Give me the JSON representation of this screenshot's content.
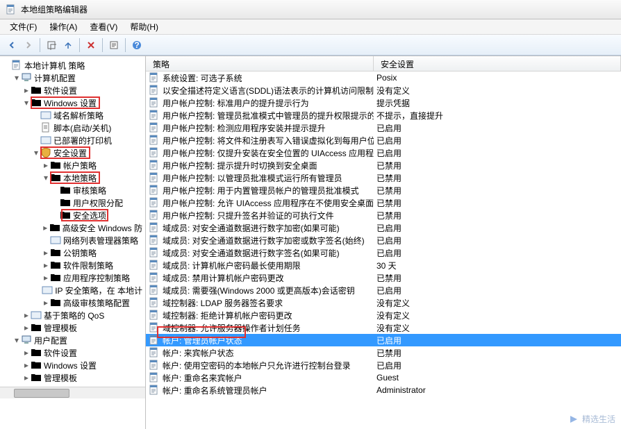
{
  "window": {
    "title": "本地组策略编辑器"
  },
  "menus": {
    "file": "文件(F)",
    "action": "操作(A)",
    "view": "查看(V)",
    "help": "帮助(H)"
  },
  "tree": {
    "root": "本地计算机 策略",
    "computer": "计算机配置",
    "soft1": "软件设置",
    "win_settings": "Windows 设置",
    "dns": "域名解析策略",
    "script": "脚本(启动/关机)",
    "printers": "已部署的打印机",
    "security": "安全设置",
    "acct_policy": "帐户策略",
    "local_policy": "本地策略",
    "audit": "审核策略",
    "user_rights": "用户权限分配",
    "sec_options": "安全选项",
    "adv_fw": "高级安全 Windows 防",
    "netlist": "网络列表管理器策略",
    "pubkey": "公钥策略",
    "softrestrict": "软件限制策略",
    "appctrl": "应用程序控制策略",
    "ipsec": "IP 安全策略，在 本地计",
    "adv_audit": "高级审核策略配置",
    "qos": "基于策略的 QoS",
    "admin_tpl1": "管理模板",
    "user": "用户配置",
    "soft2": "软件设置",
    "win_settings2": "Windows 设置",
    "admin_tpl2": "管理模板"
  },
  "columns": {
    "policy": "策略",
    "setting": "安全设置"
  },
  "rows": [
    {
      "p": "系统设置: 可选子系统",
      "s": "Posix"
    },
    {
      "p": "以安全描述符定义语言(SDDL)语法表示的计算机访问限制",
      "s": "没有定义"
    },
    {
      "p": "用户帐户控制: 标准用户的提升提示行为",
      "s": "提示凭据"
    },
    {
      "p": "用户帐户控制: 管理员批准模式中管理员的提升权限提示的...",
      "s": "不提示，直接提升"
    },
    {
      "p": "用户帐户控制: 检测应用程序安装并提示提升",
      "s": "已启用"
    },
    {
      "p": "用户帐户控制: 将文件和注册表写入错误虚拟化到每用户位置",
      "s": "已启用"
    },
    {
      "p": "用户帐户控制: 仅提升安装在安全位置的 UIAccess 应用程序",
      "s": "已启用"
    },
    {
      "p": "用户帐户控制: 提示提升时切换到安全桌面",
      "s": "已禁用"
    },
    {
      "p": "用户帐户控制: 以管理员批准模式运行所有管理员",
      "s": "已禁用"
    },
    {
      "p": "用户帐户控制: 用于内置管理员帐户的管理员批准模式",
      "s": "已禁用"
    },
    {
      "p": "用户帐户控制: 允许 UIAccess 应用程序在不使用安全桌面...",
      "s": "已禁用"
    },
    {
      "p": "用户帐户控制: 只提升签名并验证的可执行文件",
      "s": "已禁用"
    },
    {
      "p": "域成员: 对安全通道数据进行数字加密(如果可能)",
      "s": "已启用"
    },
    {
      "p": "域成员: 对安全通道数据进行数字加密或数字签名(始终)",
      "s": "已启用"
    },
    {
      "p": "域成员: 对安全通道数据进行数字签名(如果可能)",
      "s": "已启用"
    },
    {
      "p": "域成员: 计算机帐户密码最长使用期限",
      "s": "30 天"
    },
    {
      "p": "域成员: 禁用计算机帐户密码更改",
      "s": "已禁用"
    },
    {
      "p": "域成员: 需要强(Windows 2000 或更高版本)会话密钥",
      "s": "已启用"
    },
    {
      "p": "域控制器: LDAP 服务器签名要求",
      "s": "没有定义"
    },
    {
      "p": "域控制器: 拒绝计算机帐户密码更改",
      "s": "没有定义"
    },
    {
      "p": "域控制器: 允许服务器操作者计划任务",
      "s": "没有定义"
    },
    {
      "p": "帐户: 管理员帐户状态",
      "s": "已启用",
      "sel": true
    },
    {
      "p": "帐户: 来宾帐户状态",
      "s": "已禁用"
    },
    {
      "p": "帐户: 使用空密码的本地帐户只允许进行控制台登录",
      "s": "已启用"
    },
    {
      "p": "帐户: 重命名来宾帐户",
      "s": "Guest"
    },
    {
      "p": "帐户: 重命名系统管理员帐户",
      "s": "Administrator"
    }
  ],
  "watermark": "精选生活"
}
